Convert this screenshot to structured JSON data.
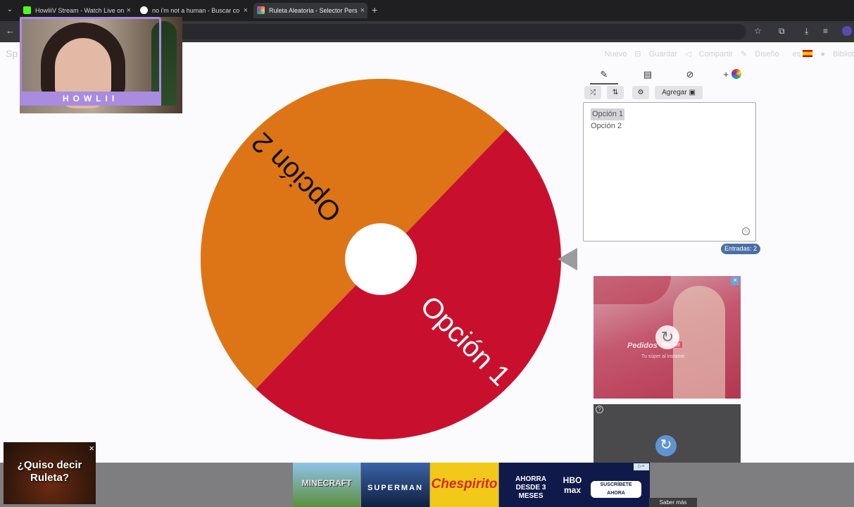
{
  "browser": {
    "tabs": [
      {
        "title": "HowliiV Stream - Watch Live on",
        "favicon_color": "#53fc18",
        "favicon": "kick-icon"
      },
      {
        "title": "no i'm not a human - Buscar co",
        "favicon_color": "#ffffff",
        "favicon": "google-icon"
      },
      {
        "title": "Ruleta Aleatoria - Selector Pers",
        "favicon_color": "#e84c8a",
        "favicon": "wheel-icon"
      }
    ],
    "new_tab": "+",
    "close_glyph": "×"
  },
  "app": {
    "logo_partial": "Sp",
    "toolbar": {
      "nuevo": "Nuevo",
      "guardar": "Guardar",
      "compartir": "Compartir",
      "diseno": "Diseño",
      "lang": "es",
      "biblioteca": "Bibliot"
    }
  },
  "wheel": {
    "segments": [
      {
        "label": "Opción 1",
        "color": "#c8102e"
      },
      {
        "label": "Opción 2",
        "color": "#dd7517"
      }
    ]
  },
  "editor": {
    "add_button": "Agregar",
    "entries": [
      "Opción 1",
      "Opción 2"
    ],
    "entries_count": "Entradas: 2"
  },
  "ads": {
    "ad1_brand": "Pedidos",
    "ad1_brand_badge": "Market",
    "ad1_tagline": "Tu súper al instante",
    "banner": [
      {
        "text": "MINECRAFT",
        "bg": "#6aa9d8"
      },
      {
        "text": "SUPERMAN",
        "bg": "#24467a"
      },
      {
        "text": "Chespirito",
        "bg": "#f2c819"
      },
      {
        "text": "AHORRA DESDE 3 MESES",
        "bg": "#101a4a"
      }
    ],
    "hbo": "HBO max",
    "suscribete": "SUSCRÍBETE AHORA",
    "saber_mas": "Saber más",
    "roulette_text": "¿Quiso decir Ruleta?"
  },
  "overlay": {
    "streamer_name": "HOWLII"
  }
}
